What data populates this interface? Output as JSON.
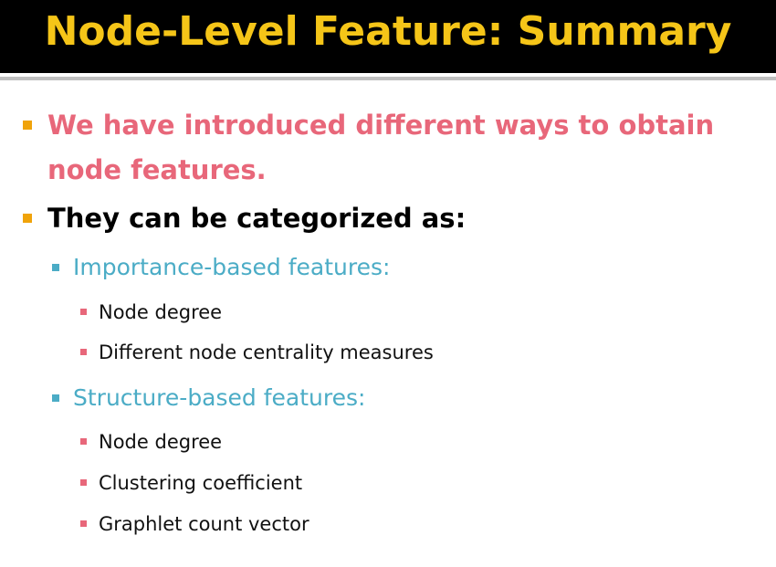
{
  "slide": {
    "title": "Node-Level Feature: Summary",
    "colors": {
      "title_bar": "#000000",
      "title_text": "#f5c518",
      "level1_bullet": "#f0a30a",
      "highlight_text": "#e8677a",
      "level2": "#4bacc6",
      "level3_bullet": "#e8677a",
      "body_text": "#111111"
    },
    "bullets": [
      {
        "line1": "We have introduced different ways to obtain",
        "line2": "node features."
      },
      {
        "text": "They can be categorized as:"
      }
    ],
    "groups": [
      {
        "label": "Importance-based features:",
        "items": [
          "Node degree",
          "Different node centrality measures"
        ]
      },
      {
        "label": "Structure-based features:",
        "items": [
          "Node degree",
          "Clustering coefficient",
          "Graphlet count vector"
        ]
      }
    ]
  }
}
